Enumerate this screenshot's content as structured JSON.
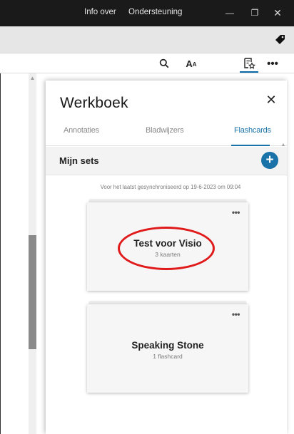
{
  "titlebar": {
    "info_label": "Info over",
    "support_label": "Ondersteuning",
    "min_glyph": "—",
    "max_glyph": "❐",
    "close_glyph": "✕",
    "bg_color": "#1a1a1a"
  },
  "toolbar": {
    "search_icon": "search-icon",
    "font_label_big": "A",
    "font_label_small": "A",
    "notes_icon": "notes-star-icon",
    "more_glyph": "•••",
    "accent_color": "#0d6aa8"
  },
  "panel": {
    "title": "Werkboek",
    "close_glyph": "✕",
    "tabs": [
      {
        "label": "Annotaties",
        "active": false
      },
      {
        "label": "Bladwijzers",
        "active": false
      },
      {
        "label": "Flashcards",
        "active": true
      }
    ],
    "sets_label": "Mijn sets",
    "add_glyph": "+",
    "sync_text": "Voor het laatst gesynchroniseerd op 19-6-2023 om 09:04",
    "cards": [
      {
        "title": "Test voor Visio",
        "subtitle": "3 kaarten",
        "more_glyph": "•••",
        "highlighted": true
      },
      {
        "title": "Speaking Stone",
        "subtitle": "1 flashcard",
        "more_glyph": "•••",
        "highlighted": false
      }
    ],
    "accent_color": "#1a73a8",
    "highlight_color": "#e01a1a"
  }
}
